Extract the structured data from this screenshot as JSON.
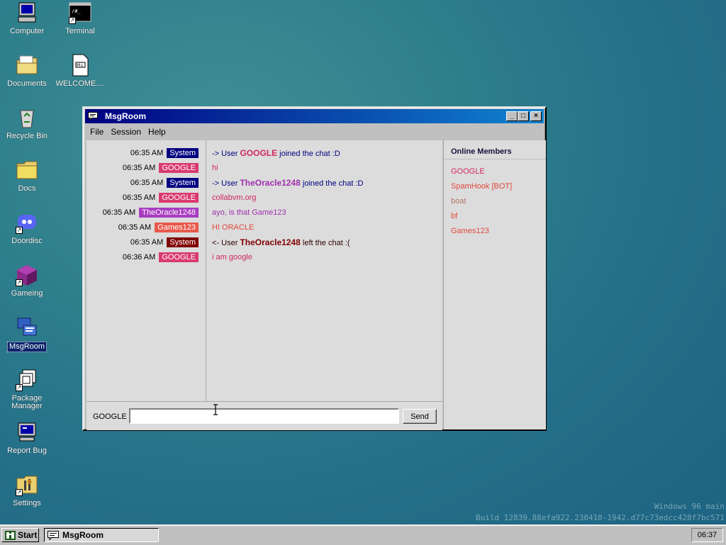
{
  "desktop": {
    "icons": [
      {
        "label": "Computer",
        "icon": "computer-icon"
      },
      {
        "label": "Terminal",
        "icon": "terminal-icon"
      },
      {
        "label": "Documents",
        "icon": "documents-folder-icon"
      },
      {
        "label": "WELCOME....",
        "icon": "markdown-file-icon"
      },
      {
        "label": "Recycle Bin",
        "icon": "recycle-bin-icon"
      },
      {
        "label": "Docs",
        "icon": "folder-icon"
      },
      {
        "label": "Doordisc",
        "icon": "doordisc-icon"
      },
      {
        "label": "Gameing",
        "icon": "game-cube-icon"
      },
      {
        "label": "MsgRoom",
        "icon": "msgroom-icon"
      },
      {
        "label": "Package Manager",
        "icon": "package-manager-icon"
      },
      {
        "label": "Report Bug",
        "icon": "report-bug-icon"
      },
      {
        "label": "Settings",
        "icon": "settings-icon"
      }
    ]
  },
  "window": {
    "title": "MsgRoom",
    "menu": [
      "File",
      "Session",
      "Help"
    ],
    "messages": [
      {
        "time": "06:35 AM",
        "user": "System",
        "user_color": "#000080",
        "text_pre": "-> User ",
        "text_bold": "GOOGLE",
        "text_post": " joined the chat :D",
        "bold_color": "#d0285e",
        "text_color": "#000080"
      },
      {
        "time": "06:35 AM",
        "user": "GOOGLE",
        "user_color": "#d93b6e",
        "text_pre": "hi",
        "text_bold": "",
        "text_post": "",
        "text_color": "#d0285e"
      },
      {
        "time": "06:35 AM",
        "user": "System",
        "user_color": "#000080",
        "text_pre": "-> User ",
        "text_bold": "TheOracle1248",
        "text_post": " joined the chat :D",
        "bold_color": "#a030b0",
        "text_color": "#000080"
      },
      {
        "time": "06:35 AM",
        "user": "GOOGLE",
        "user_color": "#d93b6e",
        "text_pre": "collabvm.org",
        "text_bold": "",
        "text_post": "",
        "text_color": "#d0285e"
      },
      {
        "time": "06:35 AM",
        "user": "TheOracle1248",
        "user_color": "#a83cc0",
        "text_pre": "ayo, is that Game123",
        "text_bold": "",
        "text_post": "",
        "text_color": "#a030b0"
      },
      {
        "time": "06:35 AM",
        "user": "Games123",
        "user_color": "#e8584a",
        "text_pre": "HI ORACLE",
        "text_bold": "",
        "text_post": "",
        "text_color": "#e0483c"
      },
      {
        "time": "06:35 AM",
        "user": "System",
        "user_color": "#800000",
        "text_pre": "<- User ",
        "text_bold": "TheOracle1248",
        "text_post": " left the chat :(",
        "bold_color": "#800000",
        "text_color": "#300000"
      },
      {
        "time": "06:36 AM",
        "user": "GOOGLE",
        "user_color": "#d93b6e",
        "text_pre": "i am google",
        "text_bold": "",
        "text_post": "",
        "text_color": "#d0285e"
      }
    ],
    "input_user": "GOOGLE",
    "input_value": "",
    "send_label": "Send",
    "members_heading": "Online Members",
    "members": [
      {
        "name": "GOOGLE",
        "color": "#d0285e"
      },
      {
        "name": "SpamHook [BOT]",
        "color": "#e0483c"
      },
      {
        "name": "boat",
        "color": "#b07868"
      },
      {
        "name": "bf",
        "color": "#e0483c"
      },
      {
        "name": "Games123",
        "color": "#e0483c"
      }
    ]
  },
  "watermark": {
    "line1": "Windows 96 main",
    "line2": "Build 12839.88efa922.230410-1942.d77c73edcc428f7bc571"
  },
  "taskbar": {
    "start_label": "Start",
    "task_label": "MsgRoom",
    "clock": "06:37"
  }
}
